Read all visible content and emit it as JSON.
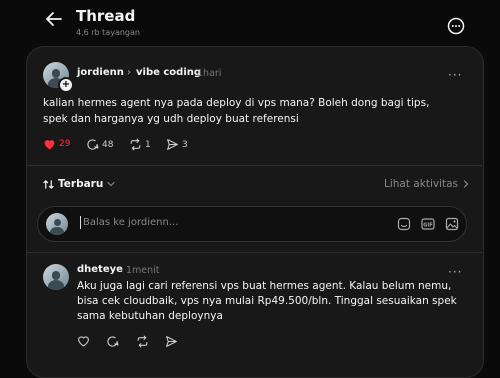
{
  "header": {
    "title": "Thread",
    "subtitle": "4,6 rb tayangan"
  },
  "post": {
    "username": "jordienn",
    "separator": "›",
    "topic": "vibe coding",
    "time": "1hari",
    "body": "kalian hermes agent nya pada deploy di vps mana? Boleh dong bagi tips, spek dan harganya yg udh deploy buat referensi",
    "likes": "29",
    "comments": "48",
    "reposts": "1",
    "shares": "3",
    "like_color": "#ff3040"
  },
  "sort": {
    "label": "Terbaru",
    "activity_label": "Lihat aktivitas"
  },
  "reply": {
    "placeholder": "Balas ke jordienn..."
  },
  "comment": {
    "username": "dheteye",
    "time": "1menit",
    "body": "Aku juga lagi cari referensi vps buat hermes agent. Kalau belum nemu, bisa cek cloudbaik, vps nya mulai Rp49.500/bln. Tinggal sesuaikan spek sama kebutuhan deploynya"
  },
  "icons": {
    "back": "arrow-left-icon",
    "more": "more-circle-icon",
    "like": "heart-icon",
    "comment": "comment-icon",
    "repost": "repost-icon",
    "share": "share-icon",
    "sort": "sort-icon",
    "chevron": "chevron-right-icon",
    "sticker": "sticker-icon",
    "gif": "gif-icon",
    "image": "image-icon"
  }
}
